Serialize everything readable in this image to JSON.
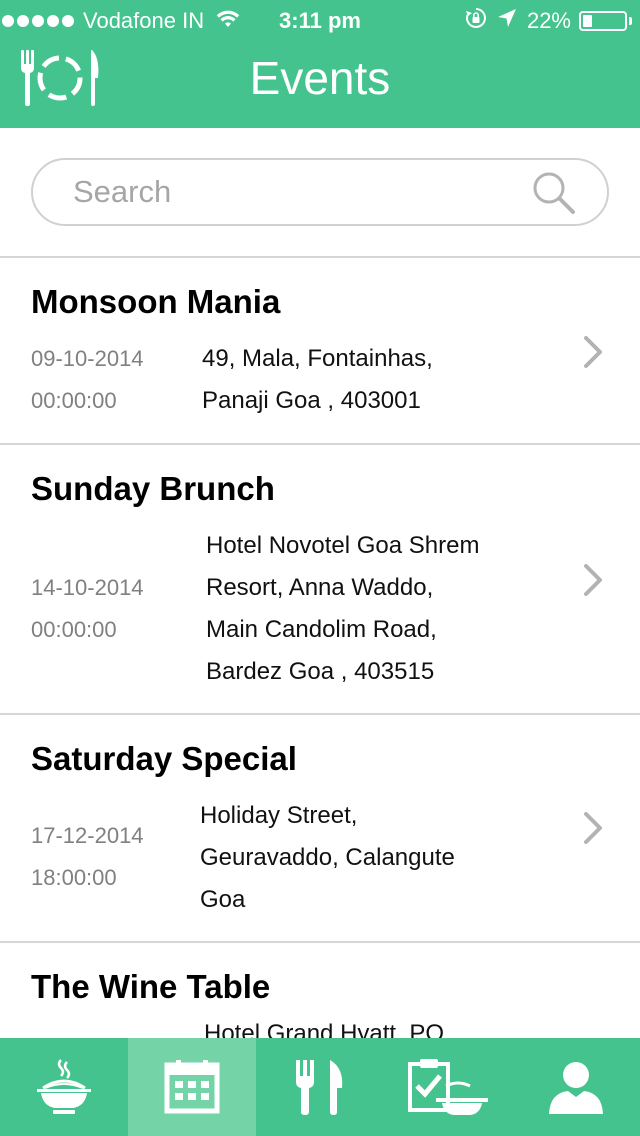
{
  "status_bar": {
    "carrier": "Vodafone IN",
    "time": "3:11 pm",
    "battery_percent_label": "22%",
    "battery_level": 0.22,
    "signal_icon": "signal-dots-icon",
    "wifi_icon": "wifi-icon",
    "rotation_lock_icon": "rotation-lock-icon",
    "location_icon": "location-arrow-icon"
  },
  "navbar": {
    "title": "Events",
    "logo_icon": "plate-cutlery-logo-icon"
  },
  "search": {
    "placeholder": "Search",
    "value": "",
    "icon": "search-icon"
  },
  "events": [
    {
      "title": "Monsoon Mania",
      "date": "09-10-2014",
      "time": "00:00:00",
      "address_lines": [
        "49, Mala, Fontainhas,",
        "Panaji Goa , 403001"
      ]
    },
    {
      "title": "Sunday Brunch",
      "date": "14-10-2014",
      "time": "00:00:00",
      "address_lines": [
        "Hotel Novotel Goa Shrem",
        "Resort, Anna Waddo,",
        "Main Candolim Road,",
        "Bardez Goa , 403515"
      ]
    },
    {
      "title": "Saturday Special",
      "date": "17-12-2014",
      "time": "18:00:00",
      "address_lines": [
        "Holiday Street,",
        "Geuravaddo, Calangute",
        "Goa"
      ]
    },
    {
      "title": "The Wine Table",
      "date": "",
      "time": "",
      "address_lines": [
        "Hotel Grand Hyatt, PO"
      ]
    }
  ],
  "tabbar": {
    "active_index": 1,
    "tabs": [
      {
        "icon": "noodle-bowl-icon"
      },
      {
        "icon": "calendar-icon"
      },
      {
        "icon": "fork-knife-icon"
      },
      {
        "icon": "checklist-dish-icon"
      },
      {
        "icon": "user-icon"
      }
    ]
  },
  "colors": {
    "brand_green": "#45c38e",
    "active_tab_green": "#74d4a8",
    "divider": "#d6d6d6",
    "secondary_text": "#808080"
  }
}
